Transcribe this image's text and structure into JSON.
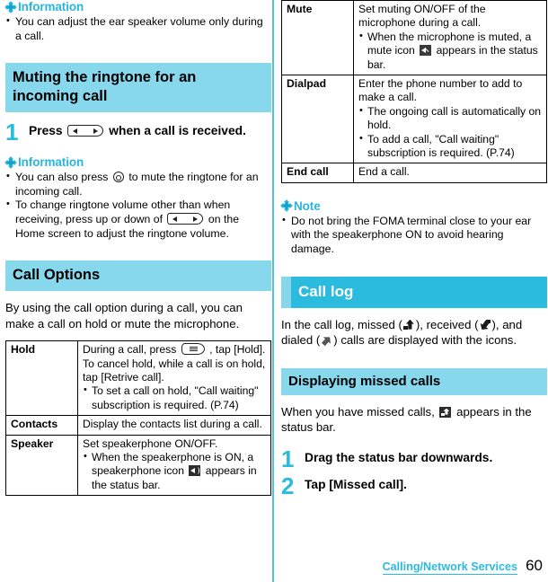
{
  "page": {
    "number": "60",
    "footer_title": "Calling/Network Services"
  },
  "left_column": {
    "info1": {
      "heading": "Information",
      "bullets": [
        "You can adjust the ear speaker volume only during a call."
      ]
    },
    "section_mute_ringtone": {
      "heading": "Muting the ringtone for an incoming call",
      "step": {
        "number": "1",
        "text_before": "Press",
        "key_icon": "volume-rocker-key-icon",
        "text_after": "when a call is received."
      }
    },
    "info2": {
      "heading": "Information",
      "bullets": [
        {
          "before": "You can also press",
          "key_icon": "round-power-key-icon",
          "after": "to mute the ringtone for an incoming call."
        },
        {
          "before": "To change ringtone volume other than when receiving, press up or down of",
          "key_icon": "volume-rocker-key-icon",
          "after": "on the Home screen to adjust the ringtone volume."
        }
      ]
    },
    "section_call_options": {
      "heading": "Call Options",
      "intro": "By using the call option during a call, you can make a call on hold or mute the microphone.",
      "rows": [
        {
          "key": "Hold",
          "lines_before_key": "During a call, press",
          "key_icon": "menu-key-icon",
          "lines_after_key": ", tap [Hold]. To cancel hold, while a call is on hold, tap [Retrive call].",
          "bullets": [
            "To set a call on hold, \"Call waiting\" subscription is required. (P.74)"
          ]
        },
        {
          "key": "Contacts",
          "text": "Display the contacts list during a call.",
          "bullets": []
        },
        {
          "key": "Speaker",
          "text": "Set speakerphone ON/OFF.",
          "bullets": [
            {
              "before": "When the speakerphone is ON, a speakerphone icon",
              "icon": "speakerphone-status-icon",
              "after": "appears in the status bar."
            }
          ]
        }
      ]
    }
  },
  "right_column": {
    "table_continued": {
      "rows": [
        {
          "key": "Mute",
          "text": "Set muting ON/OFF of the microphone during a call.",
          "bullets": [
            {
              "before": "When the microphone is muted, a mute icon",
              "icon": "mute-status-icon",
              "after": "appears in the status bar."
            }
          ]
        },
        {
          "key": "Dialpad",
          "text": "Enter the phone number to add to make a call.",
          "bullets": [
            "The ongoing call is automatically on hold.",
            "To add a call, \"Call waiting\" subscription is required. (P.74)"
          ]
        },
        {
          "key": "End call",
          "text": "End a call.",
          "bullets": []
        }
      ]
    },
    "note": {
      "heading": "Note",
      "bullets": [
        "Do not bring the FOMA terminal close to your ear with the speakerphone ON to avoid hearing damage."
      ]
    },
    "section_call_log": {
      "heading": "Call log",
      "paragraph": {
        "p1": "In the call log, missed (",
        "icon_missed": "missed-call-arrow-icon",
        "p2": "), received (",
        "icon_received": "received-call-arrow-icon",
        "p3": "), and dialed (",
        "icon_dialed": "dialed-call-arrow-icon",
        "p4": ") calls are displayed with the icons."
      }
    },
    "section_missed_calls": {
      "heading": "Displaying missed calls",
      "paragraph": {
        "p1": "When you have missed calls,",
        "icon": "missed-call-status-icon",
        "p2": "appears in the status bar."
      },
      "steps": [
        {
          "number": "1",
          "text": "Drag the status bar downwards."
        },
        {
          "number": "2",
          "text": "Tap [Missed call]."
        }
      ]
    }
  },
  "colors": {
    "accent_cyan": "#2bbbdf",
    "light_cyan": "#87d8ec",
    "text_black": "#000000"
  }
}
